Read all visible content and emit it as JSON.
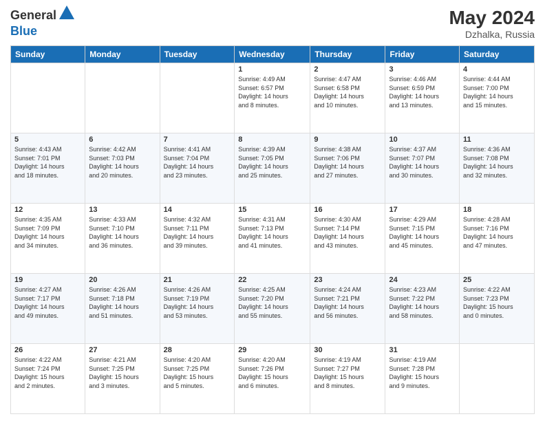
{
  "header": {
    "logo_general": "General",
    "logo_blue": "Blue",
    "month_year": "May 2024",
    "location": "Dzhalka, Russia"
  },
  "days_of_week": [
    "Sunday",
    "Monday",
    "Tuesday",
    "Wednesday",
    "Thursday",
    "Friday",
    "Saturday"
  ],
  "weeks": [
    [
      {
        "day": "",
        "info": ""
      },
      {
        "day": "",
        "info": ""
      },
      {
        "day": "",
        "info": ""
      },
      {
        "day": "1",
        "info": "Sunrise: 4:49 AM\nSunset: 6:57 PM\nDaylight: 14 hours\nand 8 minutes."
      },
      {
        "day": "2",
        "info": "Sunrise: 4:47 AM\nSunset: 6:58 PM\nDaylight: 14 hours\nand 10 minutes."
      },
      {
        "day": "3",
        "info": "Sunrise: 4:46 AM\nSunset: 6:59 PM\nDaylight: 14 hours\nand 13 minutes."
      },
      {
        "day": "4",
        "info": "Sunrise: 4:44 AM\nSunset: 7:00 PM\nDaylight: 14 hours\nand 15 minutes."
      }
    ],
    [
      {
        "day": "5",
        "info": "Sunrise: 4:43 AM\nSunset: 7:01 PM\nDaylight: 14 hours\nand 18 minutes."
      },
      {
        "day": "6",
        "info": "Sunrise: 4:42 AM\nSunset: 7:03 PM\nDaylight: 14 hours\nand 20 minutes."
      },
      {
        "day": "7",
        "info": "Sunrise: 4:41 AM\nSunset: 7:04 PM\nDaylight: 14 hours\nand 23 minutes."
      },
      {
        "day": "8",
        "info": "Sunrise: 4:39 AM\nSunset: 7:05 PM\nDaylight: 14 hours\nand 25 minutes."
      },
      {
        "day": "9",
        "info": "Sunrise: 4:38 AM\nSunset: 7:06 PM\nDaylight: 14 hours\nand 27 minutes."
      },
      {
        "day": "10",
        "info": "Sunrise: 4:37 AM\nSunset: 7:07 PM\nDaylight: 14 hours\nand 30 minutes."
      },
      {
        "day": "11",
        "info": "Sunrise: 4:36 AM\nSunset: 7:08 PM\nDaylight: 14 hours\nand 32 minutes."
      }
    ],
    [
      {
        "day": "12",
        "info": "Sunrise: 4:35 AM\nSunset: 7:09 PM\nDaylight: 14 hours\nand 34 minutes."
      },
      {
        "day": "13",
        "info": "Sunrise: 4:33 AM\nSunset: 7:10 PM\nDaylight: 14 hours\nand 36 minutes."
      },
      {
        "day": "14",
        "info": "Sunrise: 4:32 AM\nSunset: 7:11 PM\nDaylight: 14 hours\nand 39 minutes."
      },
      {
        "day": "15",
        "info": "Sunrise: 4:31 AM\nSunset: 7:13 PM\nDaylight: 14 hours\nand 41 minutes."
      },
      {
        "day": "16",
        "info": "Sunrise: 4:30 AM\nSunset: 7:14 PM\nDaylight: 14 hours\nand 43 minutes."
      },
      {
        "day": "17",
        "info": "Sunrise: 4:29 AM\nSunset: 7:15 PM\nDaylight: 14 hours\nand 45 minutes."
      },
      {
        "day": "18",
        "info": "Sunrise: 4:28 AM\nSunset: 7:16 PM\nDaylight: 14 hours\nand 47 minutes."
      }
    ],
    [
      {
        "day": "19",
        "info": "Sunrise: 4:27 AM\nSunset: 7:17 PM\nDaylight: 14 hours\nand 49 minutes."
      },
      {
        "day": "20",
        "info": "Sunrise: 4:26 AM\nSunset: 7:18 PM\nDaylight: 14 hours\nand 51 minutes."
      },
      {
        "day": "21",
        "info": "Sunrise: 4:26 AM\nSunset: 7:19 PM\nDaylight: 14 hours\nand 53 minutes."
      },
      {
        "day": "22",
        "info": "Sunrise: 4:25 AM\nSunset: 7:20 PM\nDaylight: 14 hours\nand 55 minutes."
      },
      {
        "day": "23",
        "info": "Sunrise: 4:24 AM\nSunset: 7:21 PM\nDaylight: 14 hours\nand 56 minutes."
      },
      {
        "day": "24",
        "info": "Sunrise: 4:23 AM\nSunset: 7:22 PM\nDaylight: 14 hours\nand 58 minutes."
      },
      {
        "day": "25",
        "info": "Sunrise: 4:22 AM\nSunset: 7:23 PM\nDaylight: 15 hours\nand 0 minutes."
      }
    ],
    [
      {
        "day": "26",
        "info": "Sunrise: 4:22 AM\nSunset: 7:24 PM\nDaylight: 15 hours\nand 2 minutes."
      },
      {
        "day": "27",
        "info": "Sunrise: 4:21 AM\nSunset: 7:25 PM\nDaylight: 15 hours\nand 3 minutes."
      },
      {
        "day": "28",
        "info": "Sunrise: 4:20 AM\nSunset: 7:25 PM\nDaylight: 15 hours\nand 5 minutes."
      },
      {
        "day": "29",
        "info": "Sunrise: 4:20 AM\nSunset: 7:26 PM\nDaylight: 15 hours\nand 6 minutes."
      },
      {
        "day": "30",
        "info": "Sunrise: 4:19 AM\nSunset: 7:27 PM\nDaylight: 15 hours\nand 8 minutes."
      },
      {
        "day": "31",
        "info": "Sunrise: 4:19 AM\nSunset: 7:28 PM\nDaylight: 15 hours\nand 9 minutes."
      },
      {
        "day": "",
        "info": ""
      }
    ]
  ]
}
